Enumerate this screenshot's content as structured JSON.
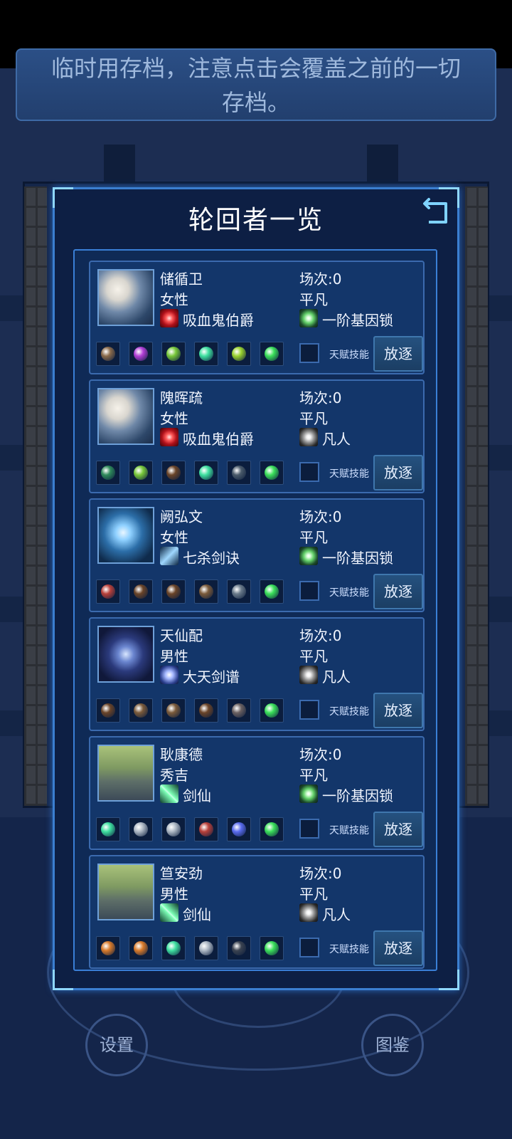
{
  "notice": {
    "line1": "临时用存档，注意点击会覆盖之前的一切",
    "line2": "存档。"
  },
  "panel": {
    "title": "轮回者一览",
    "back_icon": "return-arrow-icon"
  },
  "labels": {
    "talent": "天赋技能",
    "exile": "放逐"
  },
  "characters": [
    {
      "name": "储循卫",
      "gender": "女性",
      "skill": "吸血鬼伯爵",
      "skill_icon": "vampire-eye-icon",
      "runs": "场次:0",
      "rank": "平凡",
      "gene": "一阶基因锁",
      "gene_icon": "green-star-icon",
      "portrait": "vampire-girl-portrait",
      "items": [
        "claw-item",
        "crystal-item",
        "herb-item",
        "potion-item",
        "staff-item",
        "cycle-item"
      ]
    },
    {
      "name": "隗晖疏",
      "gender": "女性",
      "skill": "吸血鬼伯爵",
      "skill_icon": "vampire-eye-icon",
      "runs": "场次:0",
      "rank": "平凡",
      "gene": "凡人",
      "gene_icon": "white-star-icon",
      "portrait": "vampire-girl-portrait",
      "items": [
        "berry-item",
        "herb-item",
        "armor-item",
        "potion-item",
        "gun-item",
        "cycle-item"
      ]
    },
    {
      "name": "阙弘文",
      "gender": "女性",
      "skill": "七杀剑诀",
      "skill_icon": "sword-slash-icon",
      "runs": "场次:0",
      "rank": "平凡",
      "gene": "一阶基因锁",
      "gene_icon": "green-star-icon",
      "portrait": "swordswoman-portrait",
      "items": [
        "flesh-item",
        "armor-item",
        "armor-item",
        "goggles-item",
        "rifle-item",
        "cycle-item"
      ]
    },
    {
      "name": "天仙配",
      "gender": "男性",
      "skill": "大天剑谱",
      "skill_icon": "swirl-icon",
      "runs": "场次:0",
      "rank": "平凡",
      "gene": "凡人",
      "gene_icon": "white-star-icon",
      "portrait": "swordsman-vortex-portrait",
      "items": [
        "armor-item",
        "goggles-item",
        "goggles-item",
        "armor-item",
        "shotgun-item",
        "cycle-item"
      ]
    },
    {
      "name": "耿康德",
      "gender": "秀吉",
      "skill": "剑仙",
      "skill_icon": "crossed-swords-icon",
      "runs": "场次:0",
      "rank": "平凡",
      "gene": "一阶基因锁",
      "gene_icon": "green-star-icon",
      "portrait": "swordsman-cliff-portrait",
      "items": [
        "potion-item",
        "ore-item",
        "ore-item",
        "flesh-item",
        "blade-item",
        "cycle-item"
      ]
    },
    {
      "name": "笪安劲",
      "gender": "男性",
      "skill": "剑仙",
      "skill_icon": "crossed-swords-icon",
      "runs": "场次:0",
      "rank": "平凡",
      "gene": "凡人",
      "gene_icon": "white-star-icon",
      "portrait": "swordsman-cliff-portrait",
      "items": [
        "ember-item",
        "ember-item",
        "potion-item",
        "ore-item",
        "rod-item",
        "cycle-item"
      ]
    }
  ],
  "bottom": {
    "settings": "设置",
    "codex": "图鉴"
  },
  "colors": {
    "accent": "#3b7fd0",
    "panel_bg": "#0d1f44",
    "card_bg": "#13366a"
  }
}
